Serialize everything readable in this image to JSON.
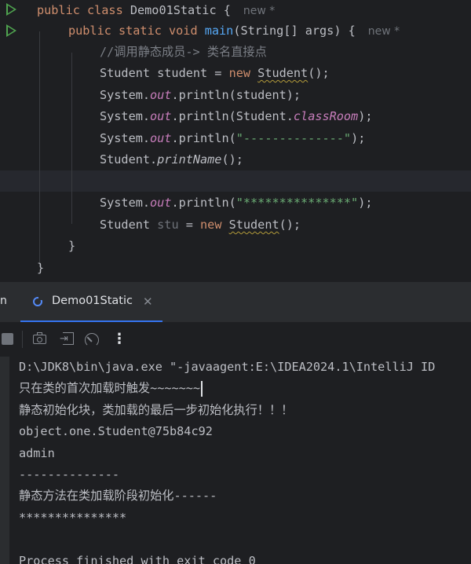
{
  "editor": {
    "line1": {
      "kw": "public class ",
      "name": "Demo01Static",
      "rest": " {",
      "hint": "new *"
    },
    "line2": {
      "kw": "public static void ",
      "name": "main",
      "rest": "(String[] args) {",
      "hint": "new *"
    },
    "line3": {
      "comment": "//调用静态成员-> 类名直接点"
    },
    "line4": {
      "pre": "Student student = ",
      "kw": "new ",
      "ctor": "Student",
      "post": "();"
    },
    "line5": {
      "pre": "System.",
      "field": "out",
      "post": ".println(student);"
    },
    "line6": {
      "pre": "System.",
      "field": "out",
      "mid": ".println(Student.",
      "field2": "classRoom",
      "post": ");"
    },
    "line7": {
      "pre": "System.",
      "field": "out",
      "mid": ".println(",
      "str": "\"--------------\"",
      "post": ");"
    },
    "line8": {
      "pre": "Student.",
      "method": "printName",
      "post": "();"
    },
    "line10": {
      "pre": "System.",
      "field": "out",
      "mid": ".println(",
      "str": "\"***************\"",
      "post": ");"
    },
    "line11": {
      "pre": "Student ",
      "var": "stu",
      "eq": " = ",
      "kw": "new ",
      "ctor": "Student",
      "post": "();"
    },
    "line12": {
      "text": "}"
    },
    "line13": {
      "text": "}"
    }
  },
  "run_window": {
    "stub_label": "n",
    "tab_label": "Demo01Static",
    "tab_close": "✕",
    "more_label": "⋮",
    "exit_arrow": "⇥"
  },
  "console": {
    "lines": [
      "D:\\JDK8\\bin\\java.exe \"-javaagent:E:\\IDEA2024.1\\IntelliJ ID",
      "只在类的首次加载时触发~~~~~~~",
      "静态初始化块，类加载的最后一步初始化执行！！！",
      "object.one.Student@75b84c92",
      "admin",
      "--------------",
      "静态方法在类加载阶段初始化------",
      "***************",
      "",
      "Process finished with exit code 0"
    ]
  },
  "colors": {
    "background": "#1e1f22",
    "keyword": "#cf8e6d",
    "function": "#56a8f5",
    "string": "#6aab73",
    "field": "#c77dbb",
    "comment": "#7a7e85",
    "run_icon": "#4fa34f",
    "tab_underline": "#3574f0"
  },
  "icons": [
    "run-icon",
    "tab-run-icon",
    "close-icon",
    "stop-icon",
    "camera-icon",
    "exit-icon",
    "gauge-icon",
    "more-icon"
  ]
}
